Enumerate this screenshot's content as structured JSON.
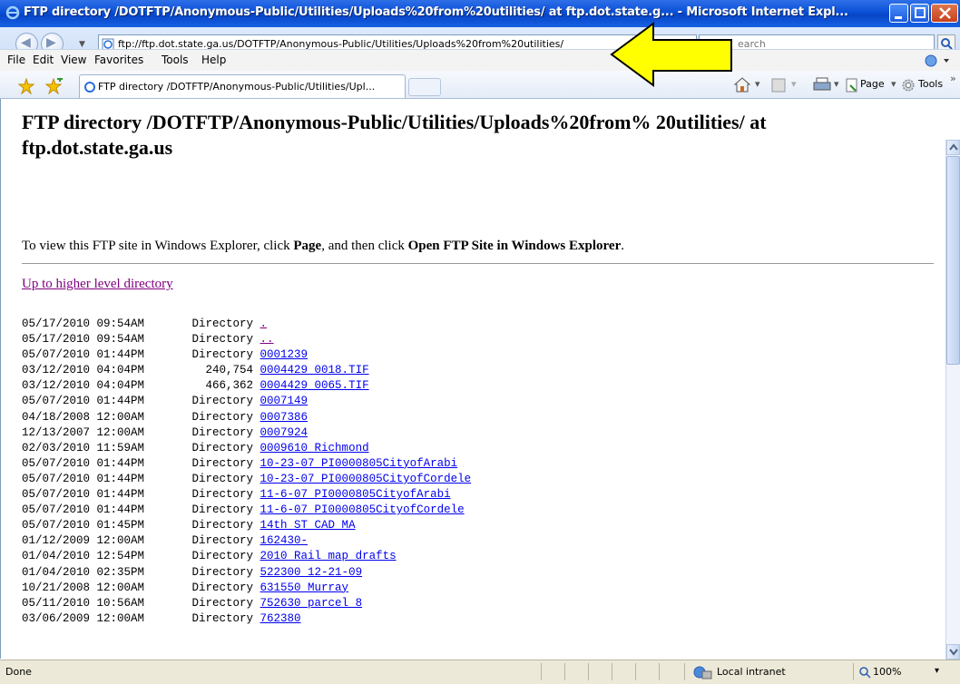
{
  "window": {
    "title": "FTP directory /DOTFTP/Anonymous-Public/Utilities/Uploads%20from%20utilities/ at ftp.dot.state.g... - Microsoft Internet Expl..."
  },
  "address": {
    "url": "ftp://ftp.dot.state.ga.us/DOTFTP/Anonymous-Public/Utilities/Uploads%20from%20utilities/",
    "search_placeholder": "earch"
  },
  "menu": {
    "file": "File",
    "edit": "Edit",
    "view": "View",
    "favorites": "Favorites",
    "tools": "Tools",
    "help": "Help"
  },
  "tab": {
    "label": "FTP directory /DOTFTP/Anonymous-Public/Utilities/Upl..."
  },
  "commands": {
    "page": "Page",
    "tools": "Tools"
  },
  "page": {
    "heading": "FTP directory /DOTFTP/Anonymous-Public/Utilities/Uploads%20from% 20utilities/ at ftp.dot.state.ga.us",
    "instruction_prefix": "To view this FTP site in Windows Explorer, click ",
    "instruction_page": "Page",
    "instruction_middle": ", and then click ",
    "instruction_open": "Open FTP Site in Windows Explorer",
    "instruction_suffix": ".",
    "up_link": "Up to higher level directory"
  },
  "listing": [
    {
      "date": "05/17/2010",
      "time": "09:54AM",
      "size": "Directory",
      "name": ".",
      "visited": true
    },
    {
      "date": "05/17/2010",
      "time": "09:54AM",
      "size": "Directory",
      "name": "..",
      "visited": true
    },
    {
      "date": "05/07/2010",
      "time": "01:44PM",
      "size": "Directory",
      "name": "0001239",
      "visited": false
    },
    {
      "date": "03/12/2010",
      "time": "04:04PM",
      "size": "240,754",
      "name": "0004429_0018.TIF",
      "visited": false
    },
    {
      "date": "03/12/2010",
      "time": "04:04PM",
      "size": "466,362",
      "name": "0004429_0065.TIF",
      "visited": false
    },
    {
      "date": "05/07/2010",
      "time": "01:44PM",
      "size": "Directory",
      "name": "0007149",
      "visited": false
    },
    {
      "date": "04/18/2008",
      "time": "12:00AM",
      "size": "Directory",
      "name": "0007386",
      "visited": false
    },
    {
      "date": "12/13/2007",
      "time": "12:00AM",
      "size": "Directory",
      "name": "0007924",
      "visited": false
    },
    {
      "date": "02/03/2010",
      "time": "11:59AM",
      "size": "Directory",
      "name": "0009610 Richmond",
      "visited": false
    },
    {
      "date": "05/07/2010",
      "time": "01:44PM",
      "size": "Directory",
      "name": "10-23-07_PI0000805CityofArabi",
      "visited": false
    },
    {
      "date": "05/07/2010",
      "time": "01:44PM",
      "size": "Directory",
      "name": "10-23-07_PI0000805CityofCordele",
      "visited": false
    },
    {
      "date": "05/07/2010",
      "time": "01:44PM",
      "size": "Directory",
      "name": "11-6-07_PI0000805CityofArabi",
      "visited": false
    },
    {
      "date": "05/07/2010",
      "time": "01:44PM",
      "size": "Directory",
      "name": "11-6-07_PI0000805CityofCordele",
      "visited": false
    },
    {
      "date": "05/07/2010",
      "time": "01:45PM",
      "size": "Directory",
      "name": "14th ST CAD MA",
      "visited": false
    },
    {
      "date": "01/12/2009",
      "time": "12:00AM",
      "size": "Directory",
      "name": "162430-",
      "visited": false
    },
    {
      "date": "01/04/2010",
      "time": "12:54PM",
      "size": "Directory",
      "name": "2010 Rail map drafts",
      "visited": false
    },
    {
      "date": "01/04/2010",
      "time": "02:35PM",
      "size": "Directory",
      "name": "522300 12-21-09",
      "visited": false
    },
    {
      "date": "10/21/2008",
      "time": "12:00AM",
      "size": "Directory",
      "name": "631550 Murray",
      "visited": false
    },
    {
      "date": "05/11/2010",
      "time": "10:56AM",
      "size": "Directory",
      "name": "752630 parcel 8",
      "visited": false
    },
    {
      "date": "03/06/2009",
      "time": "12:00AM",
      "size": "Directory",
      "name": "762380",
      "visited": false
    }
  ],
  "status": {
    "text": "Done",
    "zone": "Local intranet",
    "zoom": "100%"
  },
  "colors": {
    "link": "#0000ee",
    "visited": "#800080",
    "titlebar": "#0a4fd6",
    "arrow_fill": "#ffff00"
  }
}
